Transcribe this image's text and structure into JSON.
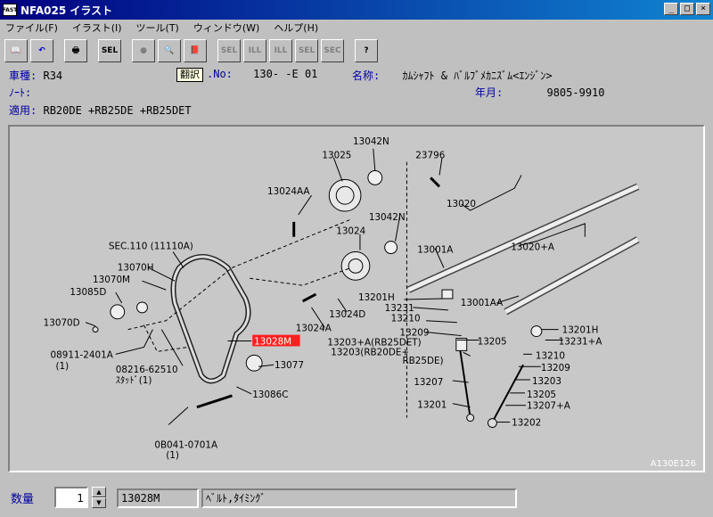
{
  "window": {
    "title": "NFA025 イラスト",
    "icon_text": "FAST"
  },
  "menu": [
    "ファイル(F)",
    "イラスト(I)",
    "ツール(T)",
    "ウィンドウ(W)",
    "ヘルプ(H)"
  ],
  "toolbar": {
    "buttons": [
      "📖",
      "↶",
      "🖶",
      "SEL",
      "●",
      "🔍",
      "📕",
      "SEL",
      "ILL",
      "ILL",
      "SEL",
      "SEC",
      "?"
    ]
  },
  "tooltip": "翻訳",
  "info": {
    "car_label": "車種:",
    "car_value": "R34",
    "illno_label": ".No:",
    "illno_value": "130-  -E 01",
    "name_label": "名称:",
    "name_value": "ｶﾑｼｬﾌﾄ & ﾊﾞﾙﾌﾞﾒｶﾆｽﾞﾑ<ｴﾝｼﾞﾝ>",
    "note_label": "ﾉｰﾄ:",
    "year_label": "年月:",
    "year_value": "9805-9910",
    "apply_label": "適用:",
    "apply_value": "RB20DE +RB25DE +RB25DET"
  },
  "diagram": {
    "labels": [
      "13042N",
      "13025",
      "23796",
      "13024AA",
      "13020",
      "13042N",
      "13024",
      "13001A",
      "13020+A",
      "SEC.110 (11110A)",
      "13070H",
      "13070M",
      "13085D",
      "13070D",
      "13201H",
      "13001AA",
      "13231",
      "13210",
      "13024D",
      "13024A",
      "13209",
      "13203+A(RB25DET)",
      "13203(RB20DE+",
      "RB25DE)",
      "13205",
      "13201H",
      "13231+A",
      "13210",
      "13209",
      "13203",
      "13205",
      "13207+A",
      "13207",
      "13201",
      "13202",
      "13077",
      "13086C",
      "08911-2401A",
      "(1)",
      "08216-62510",
      "ｽﾀｯﾄﾞ(1)",
      "0B041-0701A",
      "(1)"
    ],
    "highlight": "13028M",
    "ref_id": "A130E126"
  },
  "bottom": {
    "qty_label": "数量",
    "qty_value": "1",
    "part_no": "13028M",
    "part_name": "ﾍﾞﾙﾄ,ﾀｲﾐﾝｸﾞ"
  }
}
